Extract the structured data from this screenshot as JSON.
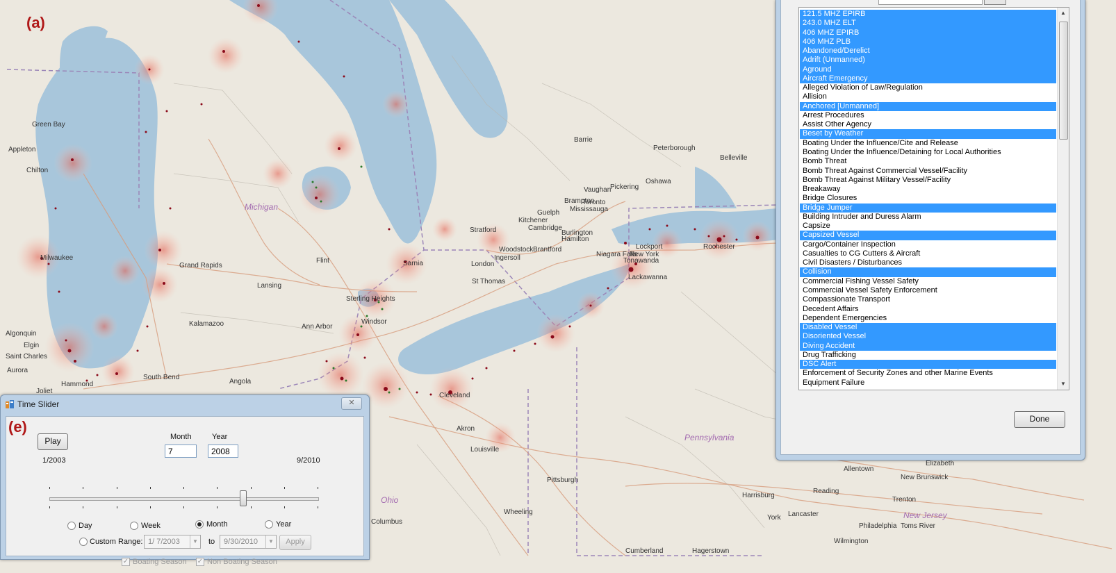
{
  "map": {
    "panel_label_a": "(a)",
    "panel_label_e": "(e)",
    "regions": [
      {
        "id": "michigan",
        "label": "Michigan"
      },
      {
        "id": "pennsylvania",
        "label": "Pennsylvania"
      },
      {
        "id": "ohio",
        "label": "Ohio"
      },
      {
        "id": "new-jersey",
        "label": "New Jersey"
      }
    ],
    "cities": [
      {
        "id": "green-bay",
        "label": "Green Bay"
      },
      {
        "id": "appleton",
        "label": "Appleton"
      },
      {
        "id": "chilton",
        "label": "Chilton"
      },
      {
        "id": "milwaukee",
        "label": "Milwaukee"
      },
      {
        "id": "algonquin",
        "label": "Algonquin"
      },
      {
        "id": "elgin",
        "label": "Elgin"
      },
      {
        "id": "saint-charles",
        "label": "Saint Charles"
      },
      {
        "id": "aurora",
        "label": "Aurora"
      },
      {
        "id": "joliet",
        "label": "Joliet"
      },
      {
        "id": "hammond",
        "label": "Hammond"
      },
      {
        "id": "south-bend",
        "label": "South Bend"
      },
      {
        "id": "angola",
        "label": "Angola"
      },
      {
        "id": "grand-rapids",
        "label": "Grand Rapids"
      },
      {
        "id": "lansing",
        "label": "Lansing"
      },
      {
        "id": "kalamazoo",
        "label": "Kalamazoo"
      },
      {
        "id": "ann-arbor",
        "label": "Ann Arbor"
      },
      {
        "id": "flint",
        "label": "Flint"
      },
      {
        "id": "sterling-heights",
        "label": "Sterling Heights"
      },
      {
        "id": "windsor",
        "label": "Windsor"
      },
      {
        "id": "sarnia",
        "label": "Sarnia"
      },
      {
        "id": "london",
        "label": "London"
      },
      {
        "id": "st-thomas",
        "label": "St Thomas"
      },
      {
        "id": "ingersoll",
        "label": "Ingersoll"
      },
      {
        "id": "woodstock",
        "label": "Woodstock"
      },
      {
        "id": "brantford",
        "label": "Brantford"
      },
      {
        "id": "stratford",
        "label": "Stratford"
      },
      {
        "id": "kitchener",
        "label": "Kitchener"
      },
      {
        "id": "cambridge",
        "label": "Cambridge"
      },
      {
        "id": "guelph",
        "label": "Guelph"
      },
      {
        "id": "burlington",
        "label": "Burlington"
      },
      {
        "id": "hamilton",
        "label": "Hamilton"
      },
      {
        "id": "brampton",
        "label": "Brampton"
      },
      {
        "id": "toronto",
        "label": "Toronto"
      },
      {
        "id": "mississauga",
        "label": "Mississauga"
      },
      {
        "id": "vaughan",
        "label": "Vaughan"
      },
      {
        "id": "pickering",
        "label": "Pickering"
      },
      {
        "id": "oshawa",
        "label": "Oshawa"
      },
      {
        "id": "barrie",
        "label": "Barrie"
      },
      {
        "id": "peterborough",
        "label": "Peterborough"
      },
      {
        "id": "belleville",
        "label": "Belleville"
      },
      {
        "id": "niagara-falls",
        "label": "Niagara Falls"
      },
      {
        "id": "new-york",
        "label": "New York"
      },
      {
        "id": "lockport",
        "label": "Lockport"
      },
      {
        "id": "tonawanda",
        "label": "Tonawanda"
      },
      {
        "id": "lackawanna",
        "label": "Lackawanna"
      },
      {
        "id": "rochester",
        "label": "Rochester"
      },
      {
        "id": "akron",
        "label": "Akron"
      },
      {
        "id": "louisville",
        "label": "Louisville"
      },
      {
        "id": "cleveland",
        "label": "Cleveland"
      },
      {
        "id": "pittsburgh",
        "label": "Pittsburgh"
      },
      {
        "id": "wheeling",
        "label": "Wheeling"
      },
      {
        "id": "columbus",
        "label": "Columbus"
      },
      {
        "id": "harrisburg",
        "label": "Harrisburg"
      },
      {
        "id": "york",
        "label": "York"
      },
      {
        "id": "lancaster",
        "label": "Lancaster"
      },
      {
        "id": "reading",
        "label": "Reading"
      },
      {
        "id": "allentown",
        "label": "Allentown"
      },
      {
        "id": "trenton",
        "label": "Trenton"
      },
      {
        "id": "philadelphia",
        "label": "Philadelphia"
      },
      {
        "id": "toms-river",
        "label": "Toms River"
      },
      {
        "id": "wilmington",
        "label": "Wilmington"
      },
      {
        "id": "new-brunswick",
        "label": "New Brunswick"
      },
      {
        "id": "elizabeth",
        "label": "Elizabeth"
      },
      {
        "id": "cumberland",
        "label": "Cumberland"
      },
      {
        "id": "hagerstown",
        "label": "Hagerstown"
      }
    ]
  },
  "time_slider": {
    "title": "Time Slider",
    "close_glyph": "✕",
    "play_label": "Play",
    "month_label": "Month",
    "year_label": "Year",
    "month_value": "7",
    "year_value": "2008",
    "range_start": "1/2003",
    "range_end": "9/2010",
    "position_fraction": 0.72,
    "step_options": [
      {
        "label": "Day",
        "selected": false
      },
      {
        "label": "Week",
        "selected": false
      },
      {
        "label": "Month",
        "selected": true
      },
      {
        "label": "Year",
        "selected": false
      }
    ],
    "custom_range_label": "Custom Range:",
    "custom_from": "1/ 7/2003",
    "to_label": "to",
    "custom_to": "9/30/2010",
    "apply_label": "Apply",
    "boating_season_label": "Boating Season",
    "non_boating_season_label": "Non Boating Season",
    "checkmark": "✓"
  },
  "categories": {
    "done_label": "Done",
    "items": [
      {
        "label": "121.5 MHZ EPIRB",
        "selected": true
      },
      {
        "label": "243.0 MHZ ELT",
        "selected": true
      },
      {
        "label": "406 MHZ EPIRB",
        "selected": true
      },
      {
        "label": "406 MHZ PLB",
        "selected": true
      },
      {
        "label": "Abandoned/Derelict",
        "selected": true
      },
      {
        "label": "Adrift (Unmanned)",
        "selected": true
      },
      {
        "label": "Aground",
        "selected": true
      },
      {
        "label": "Aircraft Emergency",
        "selected": true
      },
      {
        "label": "Alleged Violation of Law/Regulation",
        "selected": false
      },
      {
        "label": "Allision",
        "selected": false
      },
      {
        "label": "Anchored [Unmanned]",
        "selected": true
      },
      {
        "label": "Arrest Procedures",
        "selected": false
      },
      {
        "label": "Assist Other Agency",
        "selected": false
      },
      {
        "label": "Beset by Weather",
        "selected": true
      },
      {
        "label": "Boating Under the Influence/Cite and Release",
        "selected": false
      },
      {
        "label": "Boating Under the Influence/Detaining for Local Authorities",
        "selected": false
      },
      {
        "label": "Bomb Threat",
        "selected": false
      },
      {
        "label": "Bomb Threat Against Commercial Vessel/Facility",
        "selected": false
      },
      {
        "label": "Bomb Threat Against Military Vessel/Facility",
        "selected": false
      },
      {
        "label": "Breakaway",
        "selected": false
      },
      {
        "label": "Bridge Closures",
        "selected": false
      },
      {
        "label": "Bridge Jumper",
        "selected": true
      },
      {
        "label": "Building Intruder and Duress Alarm",
        "selected": false
      },
      {
        "label": "Capsize",
        "selected": false
      },
      {
        "label": "Capsized Vessel",
        "selected": true
      },
      {
        "label": "Cargo/Container Inspection",
        "selected": false
      },
      {
        "label": "Casualties to CG Cutters & Aircraft",
        "selected": false
      },
      {
        "label": "Civil Disasters /  Disturbances",
        "selected": false
      },
      {
        "label": "Collision",
        "selected": true
      },
      {
        "label": "Commercial Fishing Vessel Safety",
        "selected": false
      },
      {
        "label": "Commercial Vessel Safety Enforcement",
        "selected": false
      },
      {
        "label": "Compassionate Transport",
        "selected": false
      },
      {
        "label": "Decedent Affairs",
        "selected": false
      },
      {
        "label": "Dependent Emergencies",
        "selected": false
      },
      {
        "label": "Disabled Vessel",
        "selected": true
      },
      {
        "label": "Disoriented Vessel",
        "selected": true
      },
      {
        "label": "Diving Accident",
        "selected": true
      },
      {
        "label": "Drug Trafficking",
        "selected": false
      },
      {
        "label": "DSC Alert",
        "selected": true
      },
      {
        "label": "Enforcement of Security Zones and other Marine Events",
        "selected": false
      },
      {
        "label": "Equipment Failure",
        "selected": false
      }
    ]
  },
  "colors": {
    "selection": "#3399ff",
    "panel_label": "#b01818",
    "water": "#a8c6db",
    "land": "#ece8df",
    "heat": "#e87868",
    "incident": "#8b0a1a"
  }
}
